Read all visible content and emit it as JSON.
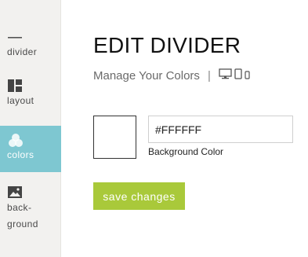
{
  "sidebar": {
    "items": [
      {
        "label": "divider",
        "icon": "divider-icon"
      },
      {
        "label": "layout",
        "icon": "layout-icon"
      },
      {
        "label": "colors",
        "icon": "colors-icon",
        "active": true
      },
      {
        "label": "back-\nground",
        "icon": "image-icon"
      }
    ]
  },
  "main": {
    "title": "EDIT DIVIDER",
    "subtitle": "Manage Your Colors",
    "separator": "|",
    "device_icons": [
      "desktop-icon",
      "tablet-icon",
      "mobile-icon"
    ]
  },
  "color_field": {
    "value": "#FFFFFF",
    "caption": "Background Color",
    "swatch_color": "#FFFFFF"
  },
  "save_button": {
    "label": "save changes"
  },
  "colors": {
    "accent_active": "#7EC7D1",
    "save_button": "#A9C93A",
    "sidebar_bg": "#F2F1EF"
  }
}
